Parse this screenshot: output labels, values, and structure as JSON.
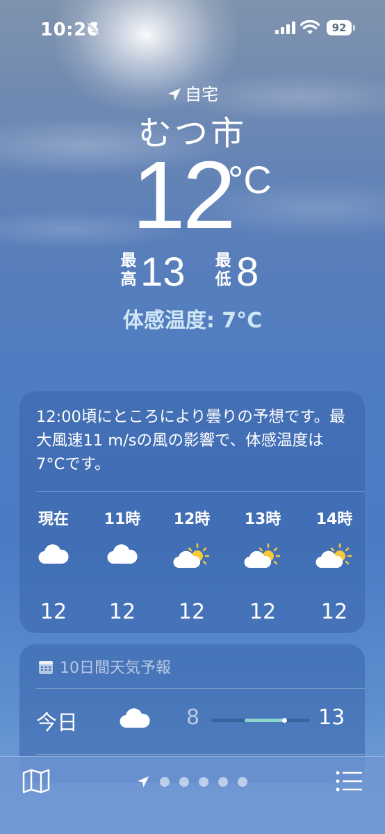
{
  "status_bar": {
    "time": "10:26",
    "battery": "92",
    "icons": [
      "bell-slash-icon",
      "cellular-signal-icon",
      "wifi-icon",
      "battery-icon"
    ]
  },
  "header": {
    "location_label": "自宅",
    "city": "むつ市",
    "temperature": "12",
    "temperature_unit": "°C",
    "high_label": "最高",
    "high_value": "13",
    "low_label": "最低",
    "low_value": "8",
    "feels_like": "体感温度: 7°C"
  },
  "hourly_card": {
    "summary": "12:00頃にところにより曇りの予想です。最大風速11 m/sの風の影響で、体感温度は7°Cです。",
    "hours": [
      {
        "label": "現在",
        "icon": "cloud-icon",
        "temp": "12"
      },
      {
        "label": "11時",
        "icon": "cloud-icon",
        "temp": "12"
      },
      {
        "label": "12時",
        "icon": "partly-sunny-icon",
        "temp": "12"
      },
      {
        "label": "13時",
        "icon": "partly-sunny-icon",
        "temp": "12"
      },
      {
        "label": "14時",
        "icon": "partly-sunny-icon",
        "temp": "12"
      }
    ]
  },
  "daily_card": {
    "title": "10日間天気予報",
    "title_icon": "calendar-icon",
    "days": [
      {
        "label": "今日",
        "icon": "cloud-icon",
        "low": "8",
        "high": "13",
        "current_marker": 0.72
      }
    ]
  },
  "bottom_bar": {
    "icons": [
      "map-icon",
      "location-arrow-icon",
      "list-icon"
    ],
    "page_count": 5,
    "current_page": 0
  },
  "colors": {
    "feels_like_text": "#cfe6f5",
    "range_fill": "#8fd6cf",
    "sun": "#f6c93a"
  }
}
